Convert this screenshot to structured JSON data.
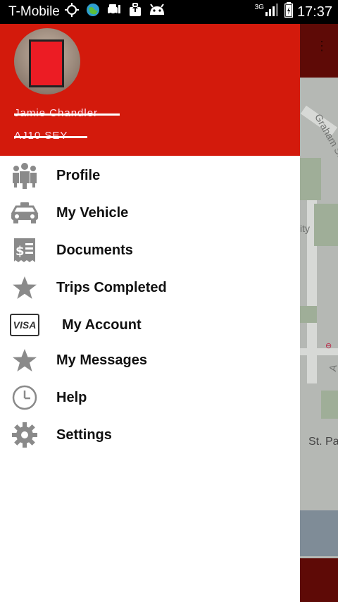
{
  "status_bar": {
    "carrier": "T-Mobile",
    "network": "3G",
    "time": "17:37"
  },
  "drawer": {
    "user_name": "Jamie Chandler",
    "user_plate": "AJ10 SEY"
  },
  "menu": [
    {
      "label": "Profile",
      "icon": "people-icon"
    },
    {
      "label": "My Vehicle",
      "icon": "car-icon"
    },
    {
      "label": "Documents",
      "icon": "receipt-icon"
    },
    {
      "label": "Trips Completed",
      "icon": "star-icon"
    },
    {
      "label": "My Account",
      "icon": "visa-card-icon",
      "icon_text": "VISA"
    },
    {
      "label": "My Messages",
      "icon": "star-icon"
    },
    {
      "label": "Help",
      "icon": "clock-icon"
    },
    {
      "label": "Settings",
      "icon": "gear-icon"
    }
  ],
  "map": {
    "street_label": "Graham St",
    "area_label": "ity",
    "road_label": "A",
    "place_label": "St. Pa"
  },
  "colors": {
    "header_red": "#d31a0c",
    "icon_gray": "#8a8a8a",
    "app_bar_dark": "#5e0a06"
  }
}
